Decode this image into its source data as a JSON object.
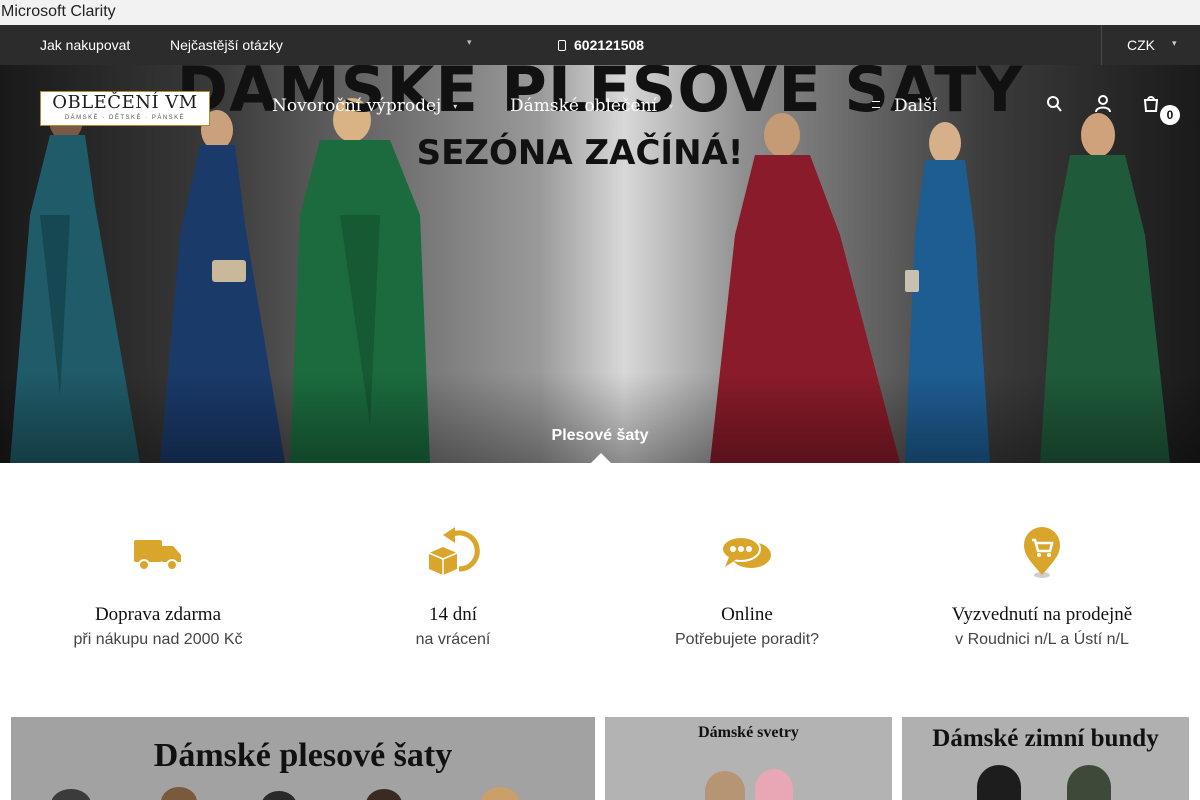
{
  "clarity": {
    "label": "Microsoft Clarity"
  },
  "topbar": {
    "links": [
      "Jak nakupovat",
      "Nejčastější otázky"
    ],
    "phone": "602121508",
    "currency": "CZK"
  },
  "header": {
    "logo": {
      "line1": "OBLEČENÍ VM",
      "line2": "DÁMSKÉ · DĚTSKÉ · PÁNSKÉ"
    },
    "nav": [
      "Novoroční výprodej",
      "Dámské oblečení"
    ],
    "more": "Další",
    "cart_count": "0",
    "icons": [
      "search-icon",
      "user-icon",
      "cart-icon"
    ]
  },
  "hero": {
    "title": "DÁMSKÉ PLESOVÉ ŠATY",
    "subtitle": "SEZÓNA ZAČÍNÁ!",
    "caption": "Plesové šaty"
  },
  "benefits": [
    {
      "icon": "truck-icon",
      "title": "Doprava zdarma",
      "sub": "při nákupu nad 2000 Kč"
    },
    {
      "icon": "return-box-icon",
      "title": "14 dní",
      "sub": "na vrácení"
    },
    {
      "icon": "chat-icon",
      "title": "Online",
      "sub": "Potřebujete poradit?"
    },
    {
      "icon": "store-pin-icon",
      "title": "Vyzvednutí na prodejně",
      "sub": "v Roudnici n/L a Ústí n/L"
    }
  ],
  "tiles": [
    {
      "title": "Dámské plesové šaty"
    },
    {
      "title": "Dámské svetry"
    },
    {
      "title": "Dámské zimní bundy"
    }
  ],
  "colors": {
    "accent": "#d9a62b",
    "topbar": "#2c2c2c",
    "tile_bg": "#9e9e9e"
  }
}
